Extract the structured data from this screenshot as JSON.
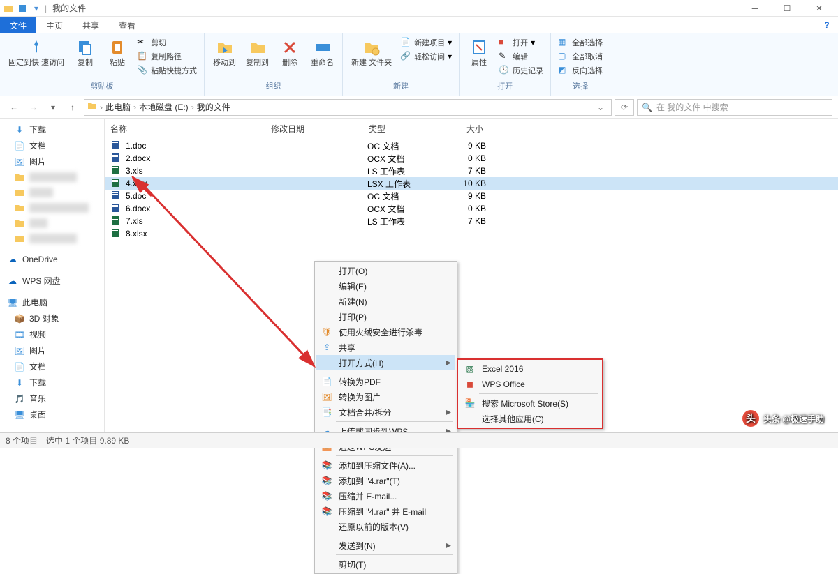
{
  "titlebar": {
    "title": "我的文件"
  },
  "tabs": {
    "file": "文件",
    "home": "主页",
    "share": "共享",
    "view": "查看"
  },
  "ribbon": {
    "group1": {
      "pin": "固定到快\n速访问",
      "copy": "复制",
      "paste": "粘贴",
      "cut": "剪切",
      "copy_path": "复制路径",
      "paste_shortcut": "粘贴快捷方式",
      "label": "剪贴板"
    },
    "group2": {
      "moveto": "移动到",
      "copyto": "复制到",
      "delete": "删除",
      "rename": "重命名",
      "label": "组织"
    },
    "group3": {
      "newfolder": "新建\n文件夹",
      "newitem": "新建项目",
      "easyaccess": "轻松访问",
      "label": "新建"
    },
    "group4": {
      "properties": "属性",
      "open": "打开",
      "edit": "编辑",
      "history": "历史记录",
      "label": "打开"
    },
    "group5": {
      "selectall": "全部选择",
      "selectnone": "全部取消",
      "invert": "反向选择",
      "label": "选择"
    }
  },
  "breadcrumb": {
    "seg1": "此电脑",
    "seg2": "本地磁盘 (E:)",
    "seg3": "我的文件"
  },
  "search": {
    "placeholder": "在 我的文件 中搜索"
  },
  "sidebar": {
    "downloads": "下载",
    "documents": "文档",
    "pictures": "图片",
    "onedrive": "OneDrive",
    "wps": "WPS 网盘",
    "thispc": "此电脑",
    "objects3d": "3D 对象",
    "videos": "视频",
    "pictures2": "图片",
    "documents2": "文档",
    "downloads2": "下载",
    "music": "音乐",
    "desktop": "桌面"
  },
  "columns": {
    "name": "名称",
    "date": "修改日期",
    "type": "类型",
    "size": "大小"
  },
  "files": [
    {
      "name": "1.doc",
      "type": "OC 文档",
      "size": "9 KB",
      "kind": "doc"
    },
    {
      "name": "2.docx",
      "type": "OCX 文档",
      "size": "0 KB",
      "kind": "doc"
    },
    {
      "name": "3.xls",
      "type": "LS 工作表",
      "size": "7 KB",
      "kind": "xls"
    },
    {
      "name": "4.xlsx",
      "type": "LSX 工作表",
      "size": "10 KB",
      "kind": "xls",
      "sel": true
    },
    {
      "name": "5.doc",
      "type": "OC 文档",
      "size": "9 KB",
      "kind": "doc"
    },
    {
      "name": "6.docx",
      "type": "OCX 文档",
      "size": "0 KB",
      "kind": "doc"
    },
    {
      "name": "7.xls",
      "type": "LS 工作表",
      "size": "7 KB",
      "kind": "xls"
    },
    {
      "name": "8.xlsx",
      "type": "",
      "size": "",
      "kind": "xls"
    }
  ],
  "ctx1": {
    "open": "打开(O)",
    "edit": "编辑(E)",
    "new": "新建(N)",
    "print": "打印(P)",
    "scan": "使用火绒安全进行杀毒",
    "share": "共享",
    "openwith": "打开方式(H)",
    "topdf": "转换为PDF",
    "toimg": "转换为图片",
    "merge": "文档合并/拆分",
    "upload": "上传或同步到WPS",
    "sendwps": "通过WPS发送",
    "addrar": "添加到压缩文件(A)...",
    "addrar2": "添加到 \"4.rar\"(T)",
    "email": "压缩并 E-mail...",
    "email2": "压缩到 \"4.rar\" 并 E-mail",
    "restore": "还原以前的版本(V)",
    "sendto": "发送到(N)",
    "cut": "剪切(T)"
  },
  "ctx2": {
    "excel": "Excel 2016",
    "wps": "WPS Office",
    "store": "搜索 Microsoft Store(S)",
    "other": "选择其他应用(C)"
  },
  "status": {
    "count": "8 个项目",
    "sel": "选中 1 个项目  9.89 KB"
  },
  "watermark": "头条 @极速手助"
}
